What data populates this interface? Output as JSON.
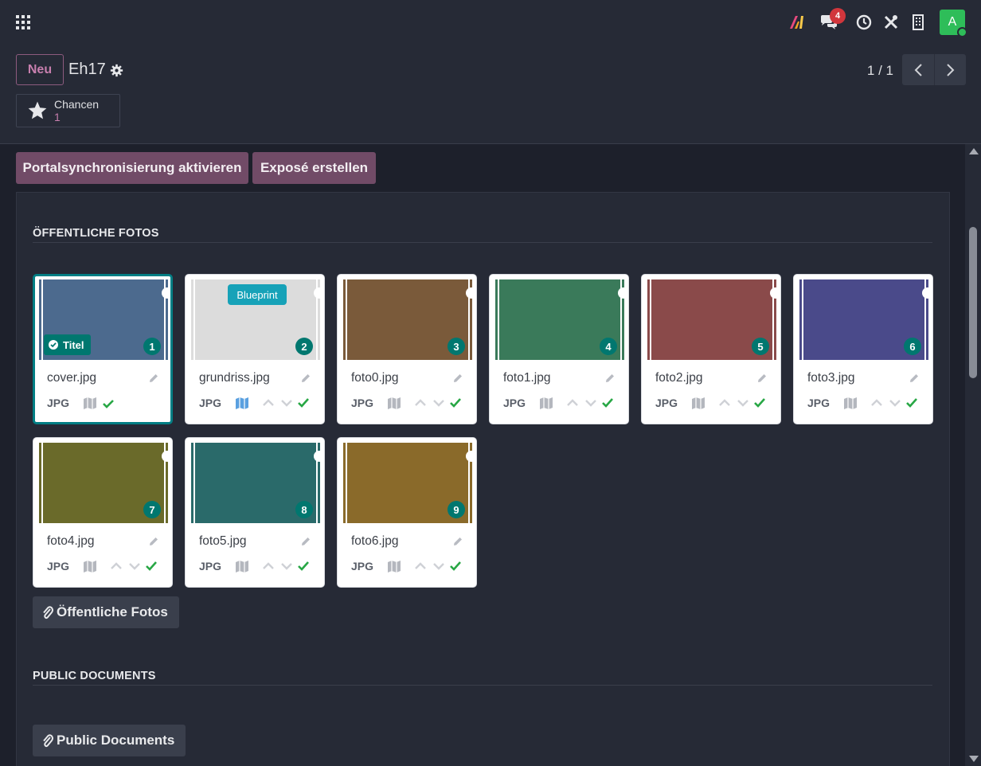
{
  "navbar": {
    "message_count": "4",
    "avatar_letter": "A"
  },
  "control_panel": {
    "new_button": "Neu",
    "record_title": "Eh17",
    "pager": "1 / 1",
    "smart_button": {
      "label": "Chancen",
      "count": "1"
    }
  },
  "header_buttons": [
    "Portalsynchronisierung aktivieren",
    "Exposé erstellen"
  ],
  "public_photos": {
    "title": "ÖFFENTLICHE FOTOS",
    "items": [
      {
        "filename": "cover.jpg",
        "type": "JPG",
        "number": "1",
        "color": "#4c6a8e",
        "badge": "Titel",
        "selected": true
      },
      {
        "filename": "grundriss.jpg",
        "type": "JPG",
        "number": "2",
        "color": "#dcdcdc",
        "badge": "Blueprint"
      },
      {
        "filename": "foto0.jpg",
        "type": "JPG",
        "number": "3",
        "color": "#7a5a3a"
      },
      {
        "filename": "foto1.jpg",
        "type": "JPG",
        "number": "4",
        "color": "#3a7a5a"
      },
      {
        "filename": "foto2.jpg",
        "type": "JPG",
        "number": "5",
        "color": "#8a4a4a"
      },
      {
        "filename": "foto3.jpg",
        "type": "JPG",
        "number": "6",
        "color": "#4a4a8a"
      },
      {
        "filename": "foto4.jpg",
        "type": "JPG",
        "number": "7",
        "color": "#6a6a2a"
      },
      {
        "filename": "foto5.jpg",
        "type": "JPG",
        "number": "8",
        "color": "#2a6a6a"
      },
      {
        "filename": "foto6.jpg",
        "type": "JPG",
        "number": "9",
        "color": "#8a6a2a"
      }
    ],
    "attach_button": "Öffentliche Fotos"
  },
  "public_documents": {
    "title": "PUBLIC DOCUMENTS",
    "attach_button": "Public Documents"
  }
}
